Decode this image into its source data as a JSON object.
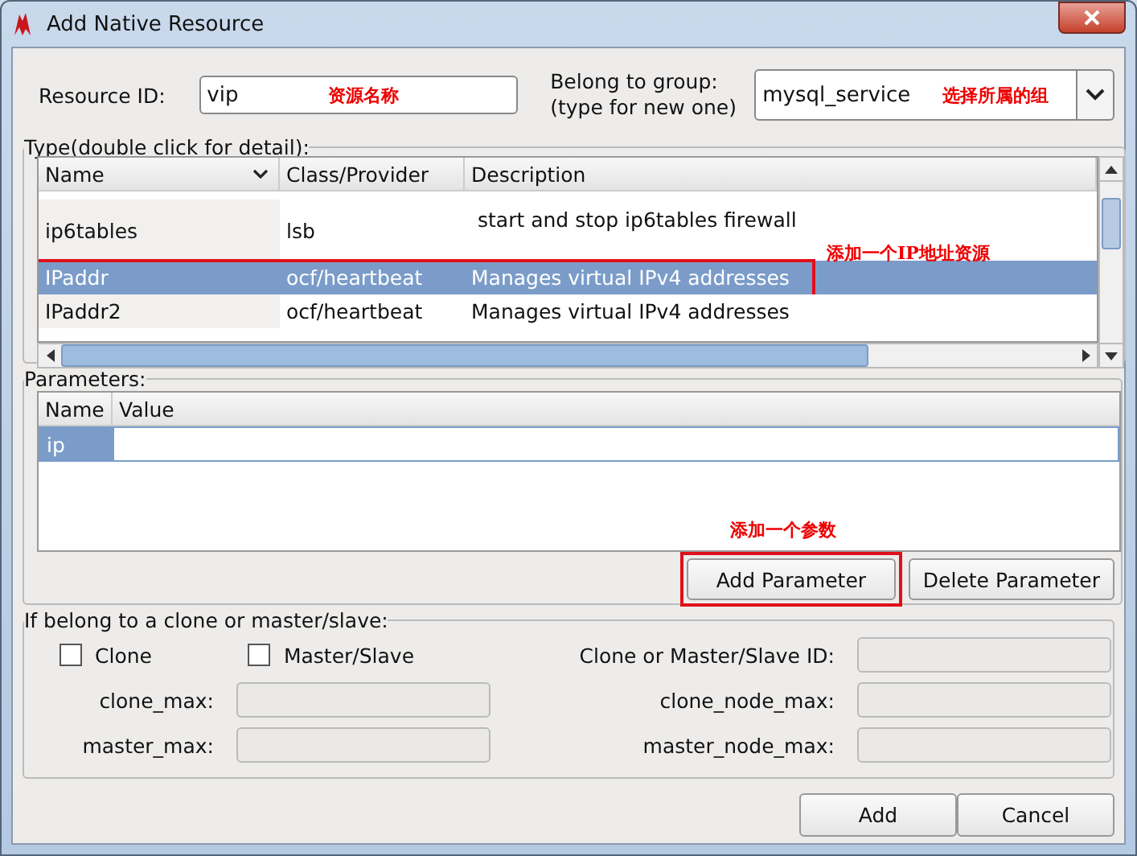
{
  "window": {
    "title": "Add Native Resource"
  },
  "resource_id": {
    "label": "Resource ID:",
    "value": "vip",
    "annotation": "资源名称"
  },
  "group": {
    "label_lines": [
      "Belong to group:",
      "(type for new one)"
    ],
    "value": "mysql_service",
    "annotation": "选择所属的组"
  },
  "type_section": {
    "legend": "Type(double click for detail):",
    "columns": [
      "Name",
      "Class/Provider",
      "Description"
    ],
    "rows": [
      {
        "name": "ip6tables",
        "provider": "lsb",
        "description": "start and stop ip6tables firewall",
        "selected": false,
        "highlighted": false
      },
      {
        "name": "IPaddr",
        "provider": "ocf/heartbeat",
        "description": "Manages virtual IPv4 addresses",
        "selected": true,
        "highlighted": true
      },
      {
        "name": "IPaddr2",
        "provider": "ocf/heartbeat",
        "description": "Manages virtual IPv4 addresses",
        "selected": false,
        "highlighted": false
      }
    ],
    "annotation": "添加一个IP地址资源"
  },
  "parameters": {
    "legend": "Parameters:",
    "columns": [
      "Name",
      "Value"
    ],
    "rows": [
      {
        "name": "ip",
        "value": "",
        "selected": true
      }
    ],
    "annotation": "添加一个参数",
    "buttons": [
      {
        "label": "Add Parameter",
        "highlighted": true
      },
      {
        "label": "Delete Parameter",
        "highlighted": false
      }
    ]
  },
  "clone": {
    "legend": "If belong to a clone or master/slave:",
    "checkboxes": [
      {
        "label": "Clone",
        "checked": false
      },
      {
        "label": "Master/Slave",
        "checked": false
      }
    ],
    "id_label": "Clone or Master/Slave ID:",
    "fields": [
      {
        "label": "clone_max:"
      },
      {
        "label": "clone_node_max:"
      },
      {
        "label": "master_max:"
      },
      {
        "label": "master_node_max:"
      }
    ]
  },
  "buttons": [
    "Add",
    "Cancel"
  ]
}
